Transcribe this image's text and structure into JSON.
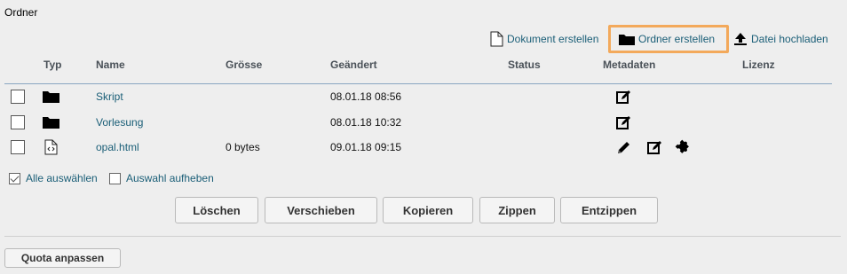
{
  "title": "Ordner",
  "toolbar": {
    "create_document": "Dokument erstellen",
    "create_folder": "Ordner erstellen",
    "upload_file": "Datei hochladen"
  },
  "columns": [
    "Typ",
    "Name",
    "Grösse",
    "Geändert",
    "Status",
    "Metadaten",
    "Lizenz"
  ],
  "rows": [
    {
      "type_icon": "folder-icon",
      "name": "Skript",
      "size": "",
      "modified": "08.01.18 08:56"
    },
    {
      "type_icon": "folder-icon",
      "name": "Vorlesung",
      "size": "",
      "modified": "08.01.18 10:32"
    },
    {
      "type_icon": "html-file-icon",
      "name": "opal.html",
      "size": "0 bytes",
      "modified": "09.01.18 09:15"
    }
  ],
  "selection": {
    "select_all": "Alle auswählen",
    "deselect": "Auswahl aufheben"
  },
  "actions": {
    "delete": "Löschen",
    "move": "Verschieben",
    "copy": "Kopieren",
    "zip": "Zippen",
    "unzip": "Entzippen"
  },
  "quota_button": "Quota anpassen",
  "colors": {
    "link": "#1a5e77",
    "highlight": "#f3a95b",
    "header_line": "#8aa6c1"
  }
}
